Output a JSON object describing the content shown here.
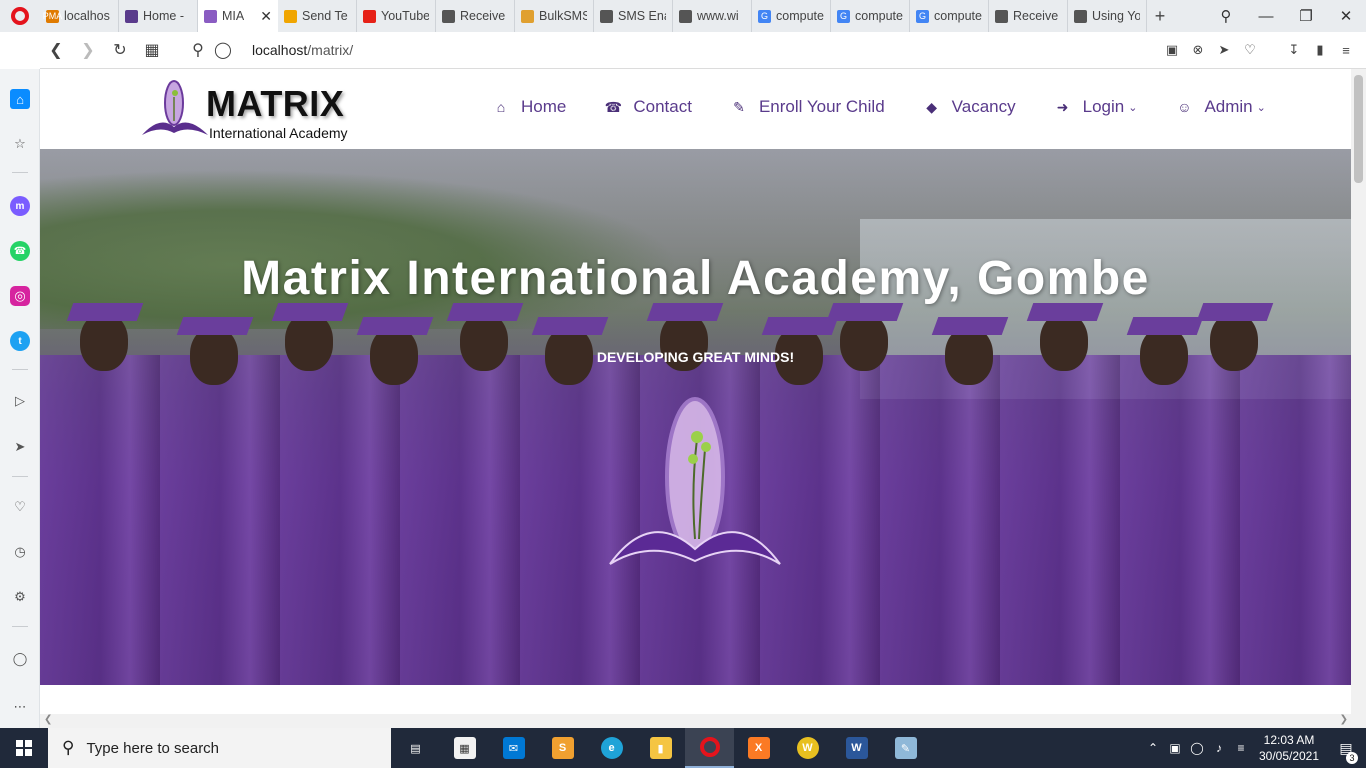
{
  "browser": {
    "tabs": [
      {
        "label": "localhos",
        "favicon": "phpmyadmin-icon",
        "favicon_text": "PMA",
        "color": "#e07b00",
        "active": false
      },
      {
        "label": "Home -",
        "favicon": "academy-icon",
        "favicon_text": "",
        "color": "#5a3b8c",
        "active": false
      },
      {
        "label": "MIA",
        "favicon": "matrix-logo-icon",
        "favicon_text": "",
        "color": "#8a5cc2",
        "active": true
      },
      {
        "label": "Send Te",
        "favicon": "smiley-icon",
        "favicon_text": "",
        "color": "#f0a500",
        "active": false
      },
      {
        "label": "YouTube",
        "favicon": "youtube-icon",
        "favicon_text": "",
        "color": "#e62117",
        "active": false
      },
      {
        "label": "Receive",
        "favicon": "document-icon",
        "favicon_text": "",
        "color": "#555555",
        "active": false
      },
      {
        "label": "BulkSMS",
        "favicon": "envelope-icon",
        "favicon_text": "",
        "color": "#e0a030",
        "active": false
      },
      {
        "label": "SMS Ena",
        "favicon": "document-icon",
        "favicon_text": "",
        "color": "#555555",
        "active": false
      },
      {
        "label": "www.wi",
        "favicon": "document-icon",
        "favicon_text": "",
        "color": "#555555",
        "active": false
      },
      {
        "label": "compute",
        "favicon": "google-icon",
        "favicon_text": "G",
        "color": "#4285f4",
        "active": false
      },
      {
        "label": "compute",
        "favicon": "google-icon",
        "favicon_text": "G",
        "color": "#4285f4",
        "active": false
      },
      {
        "label": "compute",
        "favicon": "google-icon",
        "favicon_text": "G",
        "color": "#4285f4",
        "active": false
      },
      {
        "label": "Receive",
        "favicon": "document-icon",
        "favicon_text": "",
        "color": "#555555",
        "active": false
      },
      {
        "label": "Using Yo",
        "favicon": "document-icon",
        "favicon_text": "",
        "color": "#555555",
        "active": false
      }
    ],
    "url_host": "localhost",
    "url_path": "/matrix/"
  },
  "site": {
    "brand_word": "MATRIX",
    "brand_sub": "International Academy",
    "menu": [
      {
        "label": "Home",
        "icon": "home-icon",
        "dropdown": false
      },
      {
        "label": "Contact",
        "icon": "phone-icon",
        "dropdown": false
      },
      {
        "label": "Enroll Your Child",
        "icon": "edit-icon",
        "dropdown": false
      },
      {
        "label": "Vacancy",
        "icon": "graduation-cap-icon",
        "dropdown": false
      },
      {
        "label": "Login",
        "icon": "sign-in-icon",
        "dropdown": true
      },
      {
        "label": "Admin",
        "icon": "user-icon",
        "dropdown": true
      }
    ],
    "hero_title": "Matrix International Academy, Gombe",
    "hero_subtitle": "DEVELOPING GREAT MINDS!",
    "accent_color": "#5a3b8c"
  },
  "taskbar": {
    "search_placeholder": "Type here to search",
    "time": "12:03 AM",
    "date": "30/05/2021",
    "notification_count": "3"
  }
}
